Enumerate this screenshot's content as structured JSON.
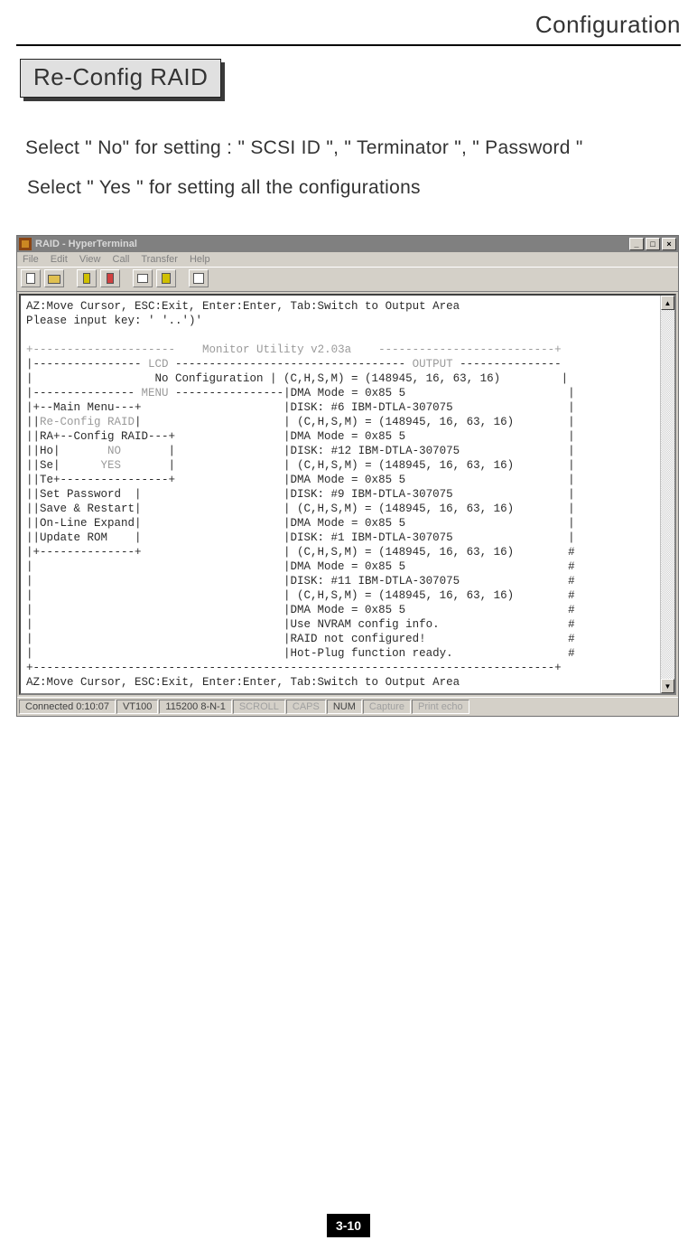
{
  "header": "Configuration",
  "subheader": "Re-Config RAID",
  "body_line1": "Select \" No\" for setting :  \" SCSI ID \", \" Terminator \", \" Password \"",
  "body_line2": "Select \" Yes \" for setting all the configurations",
  "window": {
    "title": "RAID - HyperTerminal",
    "controls": {
      "min": "_",
      "max": "□",
      "close": "×"
    },
    "menu": [
      "File",
      "Edit",
      "View",
      "Call",
      "Transfer",
      "Help"
    ]
  },
  "terminal": {
    "top1": "AZ:Move Cursor, ESC:Exit, Enter:Enter, Tab:Switch to Output Area",
    "top2": "Please input key: ' '..')'",
    "title_line": "+---------------------    Monitor Utility v2.03a    --------------------------+",
    "lines": [
      "|---------------- LCD ---------------------------------- OUTPUT ---------------",
      "|                  No Configuration | (C,H,S,M) = (148945, 16, 63, 16)         |",
      "|--------------- MENU ----------------|DMA Mode = 0x85 5                        |",
      "|+--Main Menu---+                     |DISK: #6 IBM-DTLA-307075                 |",
      "||Re-Config RAID|                     | (C,H,S,M) = (148945, 16, 63, 16)        |",
      "||RA+--Config RAID---+                |DMA Mode = 0x85 5                        |",
      "||Ho|       NO       |                |DISK: #12 IBM-DTLA-307075                |",
      "||Se|      YES       |                | (C,H,S,M) = (148945, 16, 63, 16)        |",
      "||Te+----------------+                |DMA Mode = 0x85 5                        |",
      "||Set Password  |                     |DISK: #9 IBM-DTLA-307075                 |",
      "||Save & Restart|                     | (C,H,S,M) = (148945, 16, 63, 16)        |",
      "||On-Line Expand|                     |DMA Mode = 0x85 5                        |",
      "||Update ROM    |                     |DISK: #1 IBM-DTLA-307075                 |",
      "|+--------------+                     | (C,H,S,M) = (148945, 16, 63, 16)        #",
      "|                                     |DMA Mode = 0x85 5                        #",
      "|                                     |DISK: #11 IBM-DTLA-307075                #",
      "|                                     | (C,H,S,M) = (148945, 16, 63, 16)        #",
      "|                                     |DMA Mode = 0x85 5                        #",
      "|                                     |Use NVRAM config info.                   #",
      "|                                     |RAID not configured!                     #",
      "|                                     |Hot-Plug function ready.                 #",
      "+-----------------------------------------------------------------------------+"
    ],
    "bottom": "AZ:Move Cursor, ESC:Exit, Enter:Enter, Tab:Switch to Output Area"
  },
  "status": {
    "connected": "Connected 0:10:07",
    "emulation": "VT100",
    "settings": "115200 8-N-1",
    "scroll": "SCROLL",
    "caps": "CAPS",
    "num": "NUM",
    "capture": "Capture",
    "printecho": "Print echo"
  },
  "page_number": "3-10"
}
